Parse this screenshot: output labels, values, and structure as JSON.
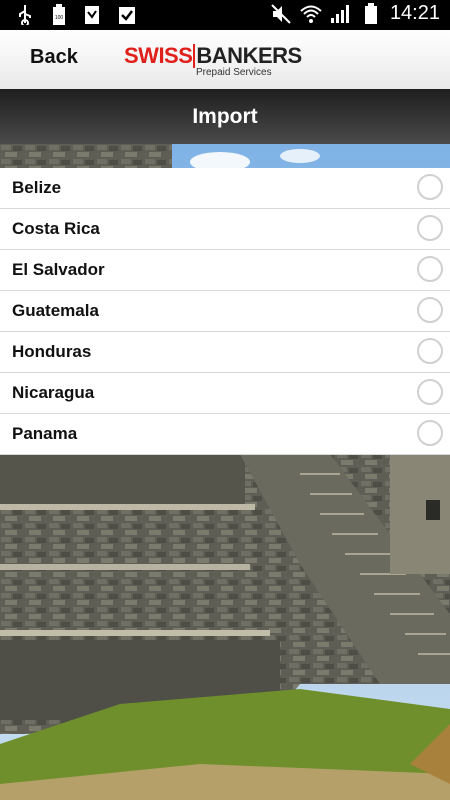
{
  "status_bar": {
    "icons": [
      "usb-icon",
      "battery-100-icon",
      "image-icon",
      "clipboard-check-icon"
    ],
    "right_icons": [
      "mute-icon",
      "wifi-icon",
      "signal-icon",
      "battery-icon"
    ],
    "time": "14:21"
  },
  "header": {
    "back_label": "Back",
    "logo_swiss": "SWISS",
    "logo_bankers": "BANKERS",
    "logo_sub": "Prepaid Services"
  },
  "title": "Import",
  "countries": [
    {
      "label": "Belize"
    },
    {
      "label": "Costa Rica"
    },
    {
      "label": "El Salvador"
    },
    {
      "label": "Guatemala"
    },
    {
      "label": "Honduras"
    },
    {
      "label": "Nicaragua"
    },
    {
      "label": "Panama"
    }
  ],
  "colors": {
    "brand_red": "#e0201b",
    "title_bar": "#2b2b2b"
  }
}
